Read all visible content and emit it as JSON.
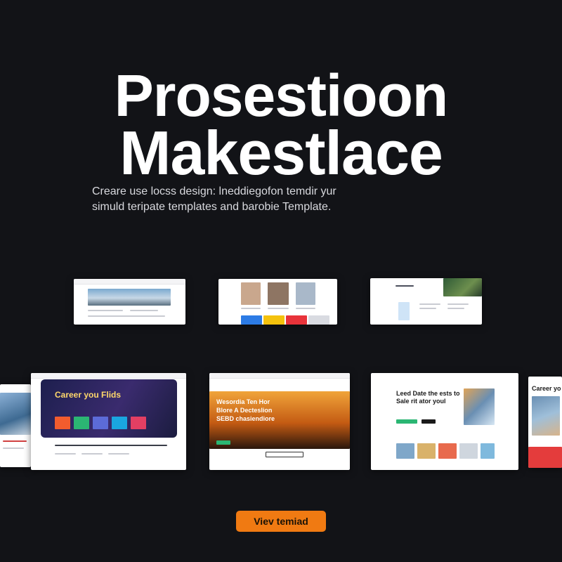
{
  "hero": {
    "title_line1": "Prosestioon",
    "title_line2": "Makestlace",
    "subtitle_line1": "Creare use locss design: lneddiegofon temdir yur",
    "subtitle_line2": "simuld teripate templates and barobie Template."
  },
  "templates": {
    "t4": {
      "headline": "Career you Flids"
    },
    "t5": {
      "headline_line1": "Wesordia Ten Hor",
      "headline_line2": "Blore A Decteslion",
      "headline_line3": "SEBD chasiendiore"
    },
    "t6": {
      "headline_line1": "Leed Date the ests to",
      "headline_line2": "Sale rit ator youl"
    },
    "t7": {
      "headline": "Career yo"
    }
  },
  "cta": {
    "label": "Viev temiad"
  },
  "colors": {
    "background": "#121317",
    "accent": "#f07a12",
    "text": "#ffffff"
  }
}
